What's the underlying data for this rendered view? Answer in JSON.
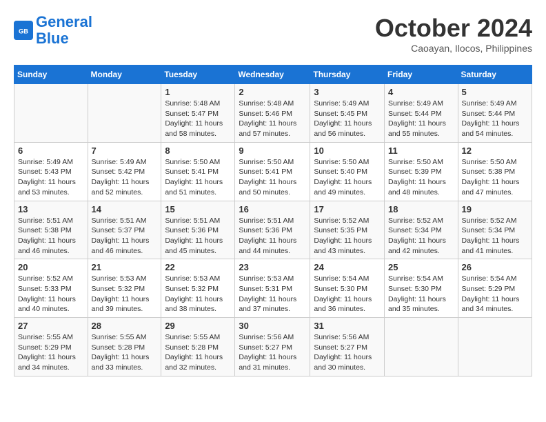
{
  "header": {
    "logo_line1": "General",
    "logo_line2": "Blue",
    "month_title": "October 2024",
    "subtitle": "Caoayan, Ilocos, Philippines"
  },
  "weekdays": [
    "Sunday",
    "Monday",
    "Tuesday",
    "Wednesday",
    "Thursday",
    "Friday",
    "Saturday"
  ],
  "weeks": [
    [
      {
        "day": "",
        "sunrise": "",
        "sunset": "",
        "daylight": ""
      },
      {
        "day": "",
        "sunrise": "",
        "sunset": "",
        "daylight": ""
      },
      {
        "day": "1",
        "sunrise": "Sunrise: 5:48 AM",
        "sunset": "Sunset: 5:47 PM",
        "daylight": "Daylight: 11 hours and 58 minutes."
      },
      {
        "day": "2",
        "sunrise": "Sunrise: 5:48 AM",
        "sunset": "Sunset: 5:46 PM",
        "daylight": "Daylight: 11 hours and 57 minutes."
      },
      {
        "day": "3",
        "sunrise": "Sunrise: 5:49 AM",
        "sunset": "Sunset: 5:45 PM",
        "daylight": "Daylight: 11 hours and 56 minutes."
      },
      {
        "day": "4",
        "sunrise": "Sunrise: 5:49 AM",
        "sunset": "Sunset: 5:44 PM",
        "daylight": "Daylight: 11 hours and 55 minutes."
      },
      {
        "day": "5",
        "sunrise": "Sunrise: 5:49 AM",
        "sunset": "Sunset: 5:44 PM",
        "daylight": "Daylight: 11 hours and 54 minutes."
      }
    ],
    [
      {
        "day": "6",
        "sunrise": "Sunrise: 5:49 AM",
        "sunset": "Sunset: 5:43 PM",
        "daylight": "Daylight: 11 hours and 53 minutes."
      },
      {
        "day": "7",
        "sunrise": "Sunrise: 5:49 AM",
        "sunset": "Sunset: 5:42 PM",
        "daylight": "Daylight: 11 hours and 52 minutes."
      },
      {
        "day": "8",
        "sunrise": "Sunrise: 5:50 AM",
        "sunset": "Sunset: 5:41 PM",
        "daylight": "Daylight: 11 hours and 51 minutes."
      },
      {
        "day": "9",
        "sunrise": "Sunrise: 5:50 AM",
        "sunset": "Sunset: 5:41 PM",
        "daylight": "Daylight: 11 hours and 50 minutes."
      },
      {
        "day": "10",
        "sunrise": "Sunrise: 5:50 AM",
        "sunset": "Sunset: 5:40 PM",
        "daylight": "Daylight: 11 hours and 49 minutes."
      },
      {
        "day": "11",
        "sunrise": "Sunrise: 5:50 AM",
        "sunset": "Sunset: 5:39 PM",
        "daylight": "Daylight: 11 hours and 48 minutes."
      },
      {
        "day": "12",
        "sunrise": "Sunrise: 5:50 AM",
        "sunset": "Sunset: 5:38 PM",
        "daylight": "Daylight: 11 hours and 47 minutes."
      }
    ],
    [
      {
        "day": "13",
        "sunrise": "Sunrise: 5:51 AM",
        "sunset": "Sunset: 5:38 PM",
        "daylight": "Daylight: 11 hours and 46 minutes."
      },
      {
        "day": "14",
        "sunrise": "Sunrise: 5:51 AM",
        "sunset": "Sunset: 5:37 PM",
        "daylight": "Daylight: 11 hours and 46 minutes."
      },
      {
        "day": "15",
        "sunrise": "Sunrise: 5:51 AM",
        "sunset": "Sunset: 5:36 PM",
        "daylight": "Daylight: 11 hours and 45 minutes."
      },
      {
        "day": "16",
        "sunrise": "Sunrise: 5:51 AM",
        "sunset": "Sunset: 5:36 PM",
        "daylight": "Daylight: 11 hours and 44 minutes."
      },
      {
        "day": "17",
        "sunrise": "Sunrise: 5:52 AM",
        "sunset": "Sunset: 5:35 PM",
        "daylight": "Daylight: 11 hours and 43 minutes."
      },
      {
        "day": "18",
        "sunrise": "Sunrise: 5:52 AM",
        "sunset": "Sunset: 5:34 PM",
        "daylight": "Daylight: 11 hours and 42 minutes."
      },
      {
        "day": "19",
        "sunrise": "Sunrise: 5:52 AM",
        "sunset": "Sunset: 5:34 PM",
        "daylight": "Daylight: 11 hours and 41 minutes."
      }
    ],
    [
      {
        "day": "20",
        "sunrise": "Sunrise: 5:52 AM",
        "sunset": "Sunset: 5:33 PM",
        "daylight": "Daylight: 11 hours and 40 minutes."
      },
      {
        "day": "21",
        "sunrise": "Sunrise: 5:53 AM",
        "sunset": "Sunset: 5:32 PM",
        "daylight": "Daylight: 11 hours and 39 minutes."
      },
      {
        "day": "22",
        "sunrise": "Sunrise: 5:53 AM",
        "sunset": "Sunset: 5:32 PM",
        "daylight": "Daylight: 11 hours and 38 minutes."
      },
      {
        "day": "23",
        "sunrise": "Sunrise: 5:53 AM",
        "sunset": "Sunset: 5:31 PM",
        "daylight": "Daylight: 11 hours and 37 minutes."
      },
      {
        "day": "24",
        "sunrise": "Sunrise: 5:54 AM",
        "sunset": "Sunset: 5:30 PM",
        "daylight": "Daylight: 11 hours and 36 minutes."
      },
      {
        "day": "25",
        "sunrise": "Sunrise: 5:54 AM",
        "sunset": "Sunset: 5:30 PM",
        "daylight": "Daylight: 11 hours and 35 minutes."
      },
      {
        "day": "26",
        "sunrise": "Sunrise: 5:54 AM",
        "sunset": "Sunset: 5:29 PM",
        "daylight": "Daylight: 11 hours and 34 minutes."
      }
    ],
    [
      {
        "day": "27",
        "sunrise": "Sunrise: 5:55 AM",
        "sunset": "Sunset: 5:29 PM",
        "daylight": "Daylight: 11 hours and 34 minutes."
      },
      {
        "day": "28",
        "sunrise": "Sunrise: 5:55 AM",
        "sunset": "Sunset: 5:28 PM",
        "daylight": "Daylight: 11 hours and 33 minutes."
      },
      {
        "day": "29",
        "sunrise": "Sunrise: 5:55 AM",
        "sunset": "Sunset: 5:28 PM",
        "daylight": "Daylight: 11 hours and 32 minutes."
      },
      {
        "day": "30",
        "sunrise": "Sunrise: 5:56 AM",
        "sunset": "Sunset: 5:27 PM",
        "daylight": "Daylight: 11 hours and 31 minutes."
      },
      {
        "day": "31",
        "sunrise": "Sunrise: 5:56 AM",
        "sunset": "Sunset: 5:27 PM",
        "daylight": "Daylight: 11 hours and 30 minutes."
      },
      {
        "day": "",
        "sunrise": "",
        "sunset": "",
        "daylight": ""
      },
      {
        "day": "",
        "sunrise": "",
        "sunset": "",
        "daylight": ""
      }
    ]
  ]
}
